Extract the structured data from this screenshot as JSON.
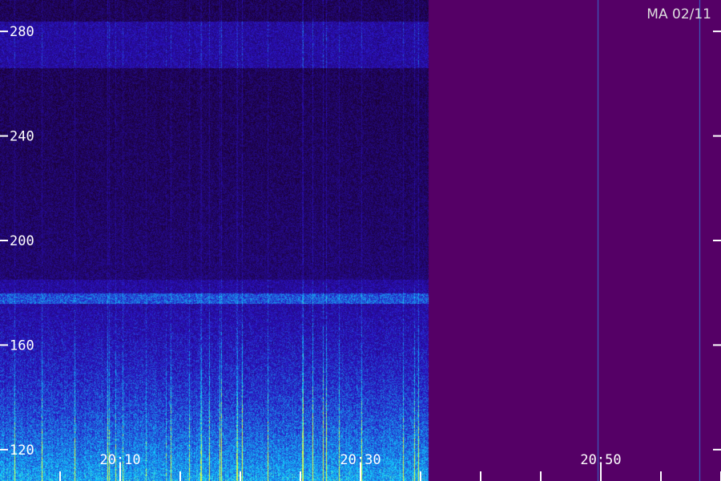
{
  "chart_data": {
    "type": "heatmap",
    "station_label": "MA 02/11",
    "y_ticks": [
      {
        "label": "280",
        "value": 280
      },
      {
        "label": "240",
        "value": 240
      },
      {
        "label": "200",
        "value": 200
      },
      {
        "label": "160",
        "value": 160
      },
      {
        "label": "120",
        "value": 120
      }
    ],
    "x_ticks": [
      {
        "label": "20:10",
        "minutes": 10
      },
      {
        "label": "20:30",
        "minutes": 30
      },
      {
        "label": "20:50",
        "minutes": 50
      }
    ],
    "x_minor_tick_minutes": [
      5,
      15,
      20,
      25,
      35,
      40,
      45,
      55,
      60
    ],
    "x_range_minutes": [
      0,
      60
    ],
    "y_range": [
      108,
      292
    ],
    "data_end_minutes": 35.6,
    "bright_bands": [
      [
        266,
        284
      ],
      [
        176,
        180
      ]
    ],
    "colors": {
      "background_nodata": "#550066",
      "tick": "#ffffff",
      "low": "#1a0030",
      "mid": "#2a10c0",
      "high": "#10d0ff",
      "peak": "#e0ff40"
    }
  }
}
